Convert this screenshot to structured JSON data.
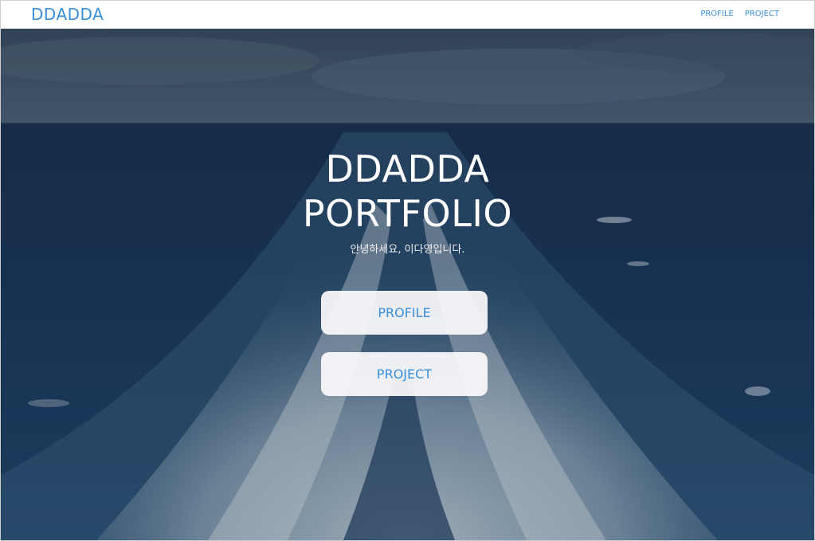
{
  "navbar": {
    "brand": "DDADDA",
    "links": [
      "PROFILE",
      "PROJECT"
    ]
  },
  "hero": {
    "title_line1": "DDADDA",
    "title_line2": "PORTFOLIO",
    "subtitle": "안녕하세요, 이다영입니다.",
    "buttons": [
      "PROFILE",
      "PROJECT"
    ]
  },
  "colors": {
    "accent": "#3a8fd9",
    "sky": "#46596e",
    "sea": "#1b3557",
    "foam": "#c9d6de"
  }
}
